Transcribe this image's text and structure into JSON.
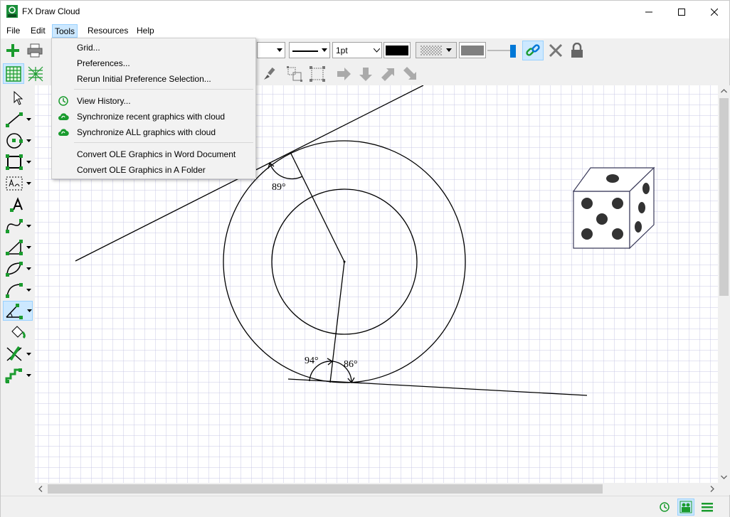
{
  "window": {
    "title": "FX Draw Cloud"
  },
  "menubar": {
    "file": "File",
    "edit": "Edit",
    "tools": "Tools",
    "resources": "Resources",
    "help": "Help"
  },
  "tools_menu": {
    "grid": "Grid...",
    "preferences": "Preferences...",
    "rerun": "Rerun Initial Preference Selection...",
    "view_history": "View History...",
    "sync_recent": "Synchronize recent graphics with cloud",
    "sync_all": "Synchronize ALL graphics with cloud",
    "convert_word": "Convert OLE Graphics in Word Document",
    "convert_folder": "Convert OLE Graphics in A Folder"
  },
  "toolbar": {
    "line_width": "1pt",
    "line_color": "#000000",
    "fill_color": "#808080"
  },
  "drawing": {
    "angle_top": "89°",
    "angle_bottom_left": "94°",
    "angle_bottom_right": "86°"
  },
  "colors": {
    "accent_green": "#1a9b2e",
    "selection_blue": "#cce8ff",
    "grid": "#c8c8e6"
  }
}
